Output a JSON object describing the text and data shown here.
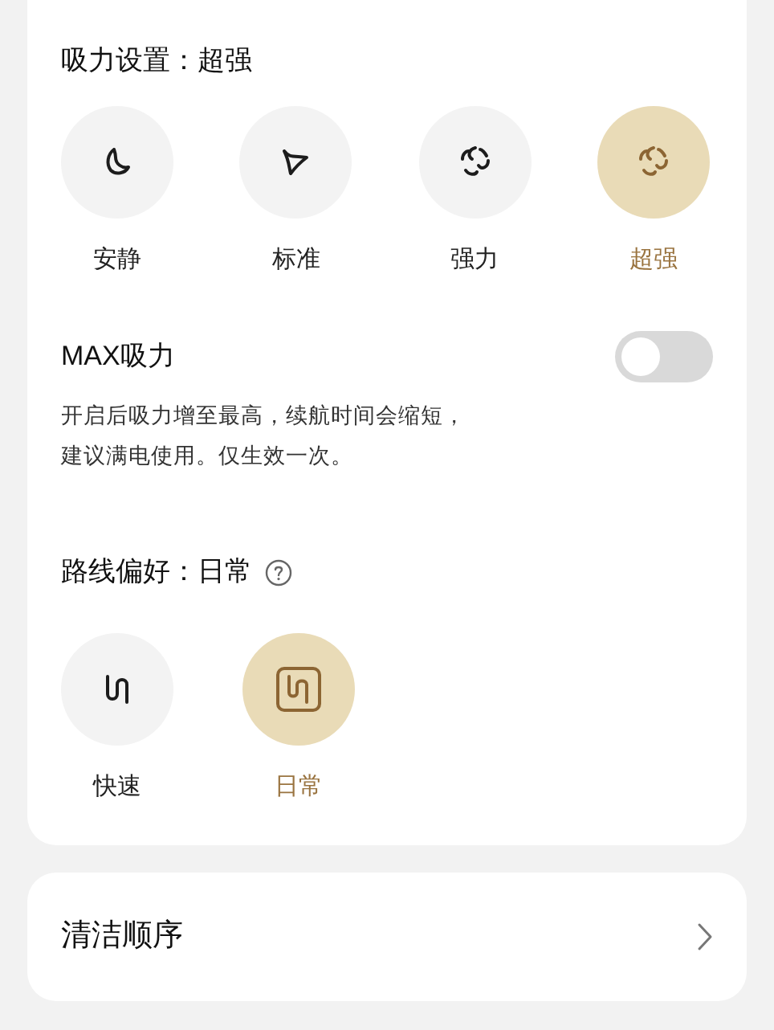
{
  "suction": {
    "title": "吸力设置：超强",
    "modes": [
      {
        "label": "安静",
        "kind": "moon",
        "selected": false
      },
      {
        "label": "标准",
        "kind": "blade",
        "selected": false
      },
      {
        "label": "强力",
        "kind": "fan",
        "selected": false
      },
      {
        "label": "超强",
        "kind": "fan",
        "selected": true
      }
    ]
  },
  "max_suction": {
    "label": "MAX吸力",
    "on": false,
    "description": "开启后吸力增至最高，续航时间会缩短，建议满电使用。仅生效一次。"
  },
  "route": {
    "title": "路线偏好：日常",
    "options": [
      {
        "label": "快速",
        "kind": "route",
        "selected": false
      },
      {
        "label": "日常",
        "kind": "route-boxed",
        "selected": true
      }
    ]
  },
  "cleaning_order": {
    "label": "清洁顺序"
  }
}
